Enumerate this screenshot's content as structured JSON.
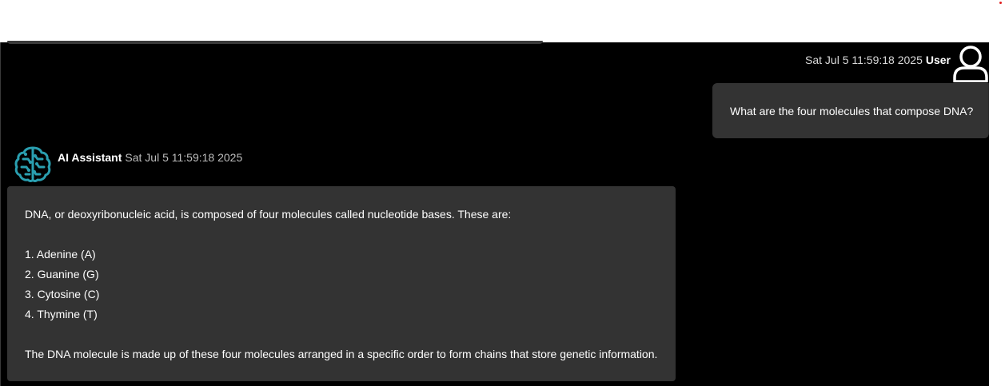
{
  "user_message": {
    "timestamp": "Sat Jul 5 11:59:18 2025",
    "sender": "User",
    "avatar_icon": "user-icon",
    "text": "What are the four molecules that compose DNA?"
  },
  "assistant_message": {
    "sender": "AI Assistant",
    "timestamp": "Sat Jul 5 11:59:18 2025",
    "avatar_icon": "brain-circuit-icon",
    "avatar_color": "#2a9fb0",
    "intro": "DNA, or deoxyribonucleic acid, is composed of four molecules called nucleotide bases. These are:",
    "list": [
      "1. Adenine (A)",
      "2. Guanine (G)",
      "3. Cytosine (C)",
      "4. Thymine (T)"
    ],
    "conclusion": "The DNA molecule is made up of these four molecules arranged in a specific order to form chains that store genetic information."
  },
  "colors": {
    "background": "#000000",
    "bubble": "#333333",
    "text": "#ffffff"
  }
}
